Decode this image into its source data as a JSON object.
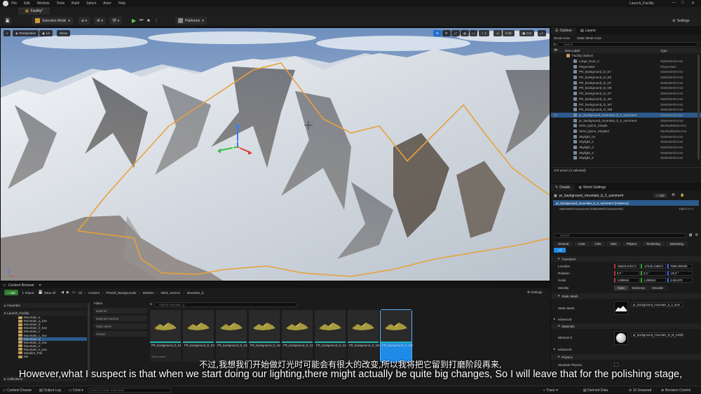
{
  "menubar": {
    "items": [
      "File",
      "Edit",
      "Window",
      "Tools",
      "Build",
      "Select",
      "Actor",
      "Help"
    ],
    "project_name": "Launch_Facility"
  },
  "tab": {
    "label": "Facility*"
  },
  "toolbar": {
    "selection_mode": "Selection Mode",
    "platforms": "Platforms",
    "settings": "Settings"
  },
  "viewport": {
    "perspective": "Perspective",
    "lit": "Lit",
    "show": "Show",
    "snap_value": "1",
    "angle_value": "0.25",
    "cam_speed": "0.3"
  },
  "outliner": {
    "tab_outliner": "Outliner",
    "tab_layers": "Layers",
    "btn_decal": "Decal Actor",
    "btn_static": "Static Mesh Actor",
    "search_placeholder": "Search",
    "col_label": "Item Label",
    "col_type": "Type",
    "rows": [
      {
        "name": "Facility (Editor)",
        "type": ""
      },
      {
        "name": "Large_Door_2",
        "type": "StaticMeshActor"
      },
      {
        "name": "PlayerStart",
        "type": "PlayerStart"
      },
      {
        "name": "PR_background_D_E7",
        "type": "StaticMeshActor"
      },
      {
        "name": "PR_background_D_E8",
        "type": "StaticMeshActor"
      },
      {
        "name": "PR_background_D_N7",
        "type": "StaticMeshActor"
      },
      {
        "name": "PR_background_D_N8",
        "type": "StaticMeshActor"
      },
      {
        "name": "PR_background_D_S7",
        "type": "StaticMeshActor"
      },
      {
        "name": "PR_background_D_S8",
        "type": "StaticMeshActor"
      },
      {
        "name": "PR_background_D_W7",
        "type": "StaticMeshActor"
      },
      {
        "name": "PR_background_D_W8",
        "type": "StaticMeshActor"
      },
      {
        "name": "pr_background_mountain_b_2_summer4",
        "type": "StaticMeshActor"
      },
      {
        "name": "pr_background_mountain_b_2_summer5",
        "type": "StaticMeshActor"
      },
      {
        "name": "SKM_Quinn_Simple",
        "type": "SkeletalMeshActor"
      },
      {
        "name": "SKM_Quinn_Simple2",
        "type": "SkeletalMeshActor"
      },
      {
        "name": "Skylight_01",
        "type": "StaticMeshActor"
      },
      {
        "name": "Skylight_2",
        "type": "StaticMeshActor"
      },
      {
        "name": "Skylight_3",
        "type": "StaticMeshActor"
      },
      {
        "name": "Skylight_4",
        "type": "StaticMeshActor"
      },
      {
        "name": "Skylight_5",
        "type": "StaticMeshActor"
      }
    ],
    "footer": "373 actors (1 selected)"
  },
  "details": {
    "tab_details": "Details",
    "tab_world": "World Settings",
    "actor_name": "pr_background_mountain_b_2_summer4",
    "add_btn": "+ Add",
    "instance": "pr_background_mountain_b_2_summer4 (Instance)",
    "component": "StaticMeshComponent (StaticMeshComponent0)",
    "edit_cpp": "Edit in C++",
    "search_placeholder": "Search",
    "filters": [
      "General",
      "Actor",
      "LOD",
      "Misc",
      "Physics",
      "Rendering",
      "Streaming",
      "All"
    ],
    "transform": "Transform",
    "location": "Location",
    "rotation": "Rotation",
    "scale": "Scale",
    "loc_values": [
      "-60620.679171",
      "-37245.148971",
      "7608.000038"
    ],
    "rot_values": [
      "0.0 °",
      "0.0 °",
      "-20.0 °"
    ],
    "scale_values": [
      "1.838544",
      "1.838544",
      "4.651278"
    ],
    "mobility": "Mobility",
    "mobility_opts": [
      "Static",
      "Stationary",
      "Movable"
    ],
    "static_mesh_section": "Static Mesh",
    "static_mesh_label": "Static Mesh",
    "static_mesh_value": "pr_background_mountain_b_2_sum",
    "advanced": "Advanced",
    "materials": "Materials",
    "element0": "Element 0",
    "element0_value": "pr_background_mountain_B_M_winter",
    "advanced2": "Advanced",
    "physics": "Physics",
    "simulate": "Simulate Physics"
  },
  "content_browser": {
    "title": "Content Browser",
    "add": "+ Add",
    "import": "Import",
    "save_all": "Save All",
    "breadcrumb": [
      "All",
      "Content",
      "Photoft_Backgrounds",
      "Meshes",
      "360d_Horizon",
      "Mountain_d"
    ],
    "settings": "Settings",
    "favorites": "Favorites",
    "project": "Launch_Facility",
    "filters_title": "Filters",
    "filter_items": [
      "Material",
      "Material Function",
      "Static Mesh",
      "Texture"
    ],
    "search_placeholder": "Search Mountain_d",
    "tree": [
      "Mountain_a",
      "Mountain_a_low",
      "Mountain_b",
      "Mountain_b_low",
      "Mountain_c",
      "Mountain_c_low",
      "Mountain_d",
      "Mountain_d_low",
      "Mountain_e",
      "Mountain_e_low",
      "Modular_Pull",
      "Mo"
    ],
    "collections": "Collections",
    "assets": [
      {
        "name": "PR_background_D_E1",
        "type": "Static Mesh"
      },
      {
        "name": "PR_background_D_E8",
        "type": ""
      },
      {
        "name": "PR_background_D_N1",
        "type": ""
      },
      {
        "name": "PR_background_D_N2",
        "type": ""
      },
      {
        "name": "PR_background_D_S1",
        "type": ""
      },
      {
        "name": "PR_background_D_S2",
        "type": ""
      },
      {
        "name": "PR_background_D_W1",
        "type": ""
      },
      {
        "name": "PR_background_D_W2",
        "type": ""
      }
    ]
  },
  "subtitles": {
    "cn": "不过,我想我们开始做灯光时可能会有很大的改变,所以我将把它留到打磨阶段再来,",
    "en": "However,what I suspect is that when we start doing our lighting,there might actually be quite big changes, So I will leave that for the polishing stage,"
  },
  "statusbar": {
    "content_drawer": "Content Drawer",
    "output_log": "Output Log",
    "cmd": "Cmd",
    "console_placeholder": "Enter Console Command",
    "trace": "Trace",
    "derived": "Derived Data",
    "unsaved": "10 Unsaved",
    "revision": "Revision Control"
  },
  "colors": {
    "accent": "#1e8be6",
    "selection": "#2c5a8c",
    "spline": "#e8a23a"
  }
}
